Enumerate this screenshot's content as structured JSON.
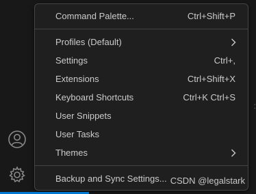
{
  "menu": {
    "items": [
      {
        "label": "Command Palette...",
        "shortcut": "Ctrl+Shift+P"
      },
      {
        "separator": true
      },
      {
        "label": "Profiles (Default)",
        "submenu": true
      },
      {
        "label": "Settings",
        "shortcut": "Ctrl+,"
      },
      {
        "label": "Extensions",
        "shortcut": "Ctrl+Shift+X"
      },
      {
        "label": "Keyboard Shortcuts",
        "shortcut": "Ctrl+K Ctrl+S"
      },
      {
        "label": "User Snippets"
      },
      {
        "label": "User Tasks"
      },
      {
        "label": "Themes",
        "submenu": true
      },
      {
        "separator": true
      },
      {
        "label": "Backup and Sync Settings..."
      }
    ]
  },
  "activity_bar": {
    "icons": [
      "account-icon",
      "manage-gear-icon"
    ]
  },
  "watermark": "CSDN @legalstark",
  "colors": {
    "menu_bg": "#1f1f1f",
    "text": "#cccccc",
    "border": "#454545",
    "accent": "#0078d4"
  }
}
